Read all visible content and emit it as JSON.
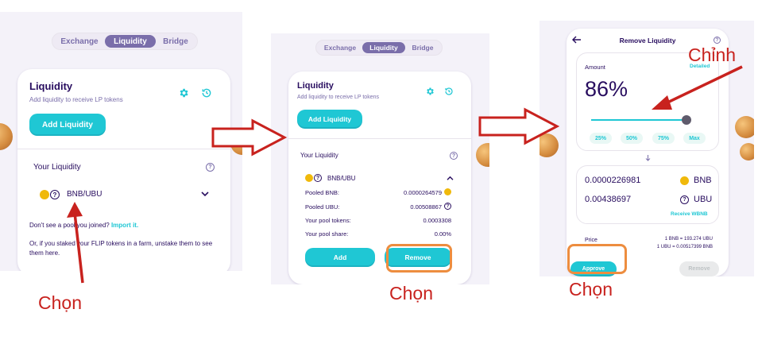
{
  "tabs": [
    "Exchange",
    "Liquidity",
    "Bridge"
  ],
  "liquidity": {
    "title": "Liquidity",
    "subtitle": "Add liquidity to receive LP tokens",
    "add_button": "Add Liquidity",
    "your_liquidity": "Your Liquidity",
    "pair": "BNB/UBU",
    "not_see_text": "Don't see a pool you joined?",
    "import_link": "Import it.",
    "staked_text": "Or, if you staked your FLIP tokens in a farm, unstake them to see them here."
  },
  "pool": {
    "rows": [
      {
        "label": "Pooled BNB:",
        "value": "0.0000264579"
      },
      {
        "label": "Pooled UBU:",
        "value": "0.00508867"
      },
      {
        "label": "Your pool tokens:",
        "value": "0.0003308"
      },
      {
        "label": "Your pool share:",
        "value": "0.00%"
      }
    ],
    "add_button": "Add",
    "remove_button": "Remove"
  },
  "remove": {
    "title": "Remove Liquidity",
    "amount_label": "Amount",
    "detailed_link": "Detailed",
    "percent": "86%",
    "percent_value": 0.86,
    "chips": [
      "25%",
      "50%",
      "75%",
      "Max"
    ],
    "bnb_amount": "0.0000226981",
    "bnb_symbol": "BNB",
    "ubu_amount": "0.00438697",
    "ubu_symbol": "UBU",
    "receive_link": "Receive WBNB",
    "price_label": "Price",
    "price_line1": "1 BNB = 193.274 UBU",
    "price_line2": "1 UBU = 0.00517399 BNB",
    "approve_button": "Approve",
    "remove_button": "Remove"
  },
  "annotations": {
    "chon": "Chọn",
    "chinh": "Chỉnh"
  },
  "colors": {
    "accent": "#1fc7d4",
    "tab_active": "#7a6eaa",
    "text": "#280d5f",
    "highlight": "#ed8d3f",
    "annotation": "#c8221e"
  }
}
